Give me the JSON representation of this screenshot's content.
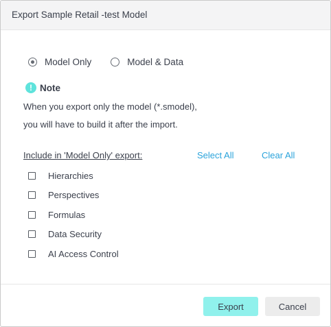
{
  "dialog": {
    "title": "Export Sample Retail -test Model"
  },
  "export_mode": {
    "options": [
      {
        "label": "Model Only",
        "selected": true
      },
      {
        "label": "Model & Data",
        "selected": false
      }
    ]
  },
  "note": {
    "title": "Note",
    "icon": "exclamation-icon",
    "line1": "When you export only the model (*.smodel),",
    "line2": "you will have to build it after the import."
  },
  "include": {
    "label": "Include in 'Model Only' export:",
    "select_all": "Select All",
    "clear_all": "Clear All",
    "items": [
      {
        "label": "Hierarchies",
        "checked": false
      },
      {
        "label": "Perspectives",
        "checked": false
      },
      {
        "label": "Formulas",
        "checked": false
      },
      {
        "label": "Data Security",
        "checked": false
      },
      {
        "label": "AI Access Control",
        "checked": false
      }
    ]
  },
  "footer": {
    "export_label": "Export",
    "cancel_label": "Cancel"
  },
  "colors": {
    "accent": "#90f1ec",
    "link": "#2aa3db",
    "note_icon": "#5fe3dc"
  }
}
